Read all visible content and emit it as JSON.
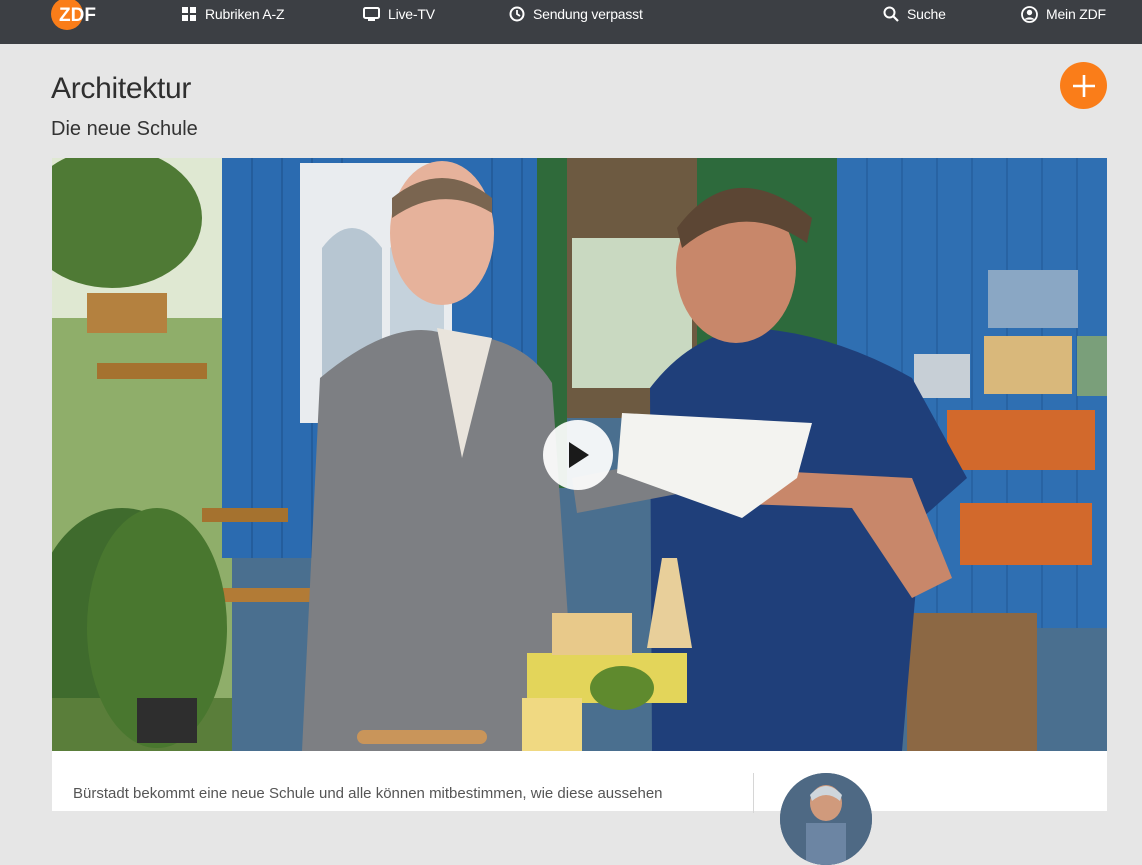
{
  "nav": {
    "logo_text": "ZDF",
    "items": [
      {
        "label": "Rubriken A-Z",
        "icon": "grid-icon"
      },
      {
        "label": "Live-TV",
        "icon": "tv-icon"
      },
      {
        "label": "Sendung verpasst",
        "icon": "clock-icon"
      },
      {
        "label": "Suche",
        "icon": "search-icon"
      },
      {
        "label": "Mein ZDF",
        "icon": "user-icon"
      }
    ]
  },
  "page": {
    "title": "Architektur",
    "subtitle": "Die neue Schule"
  },
  "video": {
    "thumbnail": "Two men in a garden by a blue wooden trailer; one in a grey suit, one in a blue t-shirt holding papers, with a wooden architecture model",
    "play_icon": "play-icon"
  },
  "description": {
    "text": "Bürstadt bekommt eine neue Schule und alle können mitbestimmen, wie diese aussehen"
  },
  "colors": {
    "nav_background": "#3c3f44",
    "accent": "#fa7d19",
    "page_background": "#e6e6e6"
  }
}
